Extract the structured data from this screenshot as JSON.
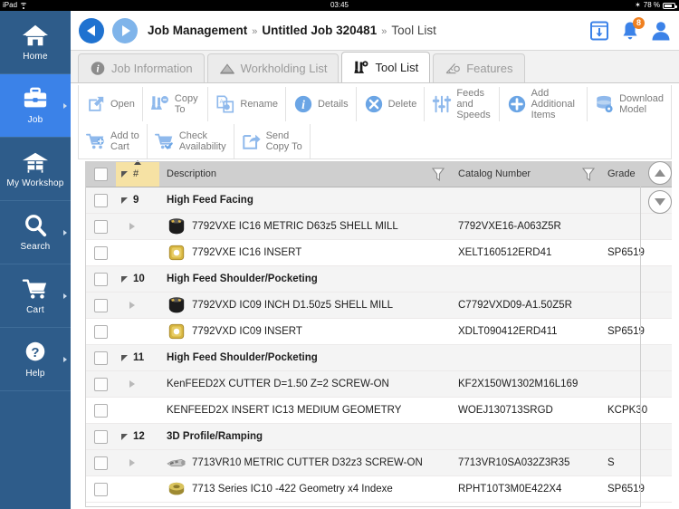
{
  "status_bar": {
    "device": "iPad",
    "wifi_icon": "wifi-icon",
    "time": "03:45",
    "bluetooth_icon": "bluetooth-icon",
    "battery_percent": "78 %",
    "battery_icon": "battery-icon"
  },
  "sidebar": {
    "items": [
      {
        "label": "Home",
        "icon": "home-icon",
        "active": false,
        "chevron": false
      },
      {
        "label": "Job",
        "icon": "briefcase-icon",
        "active": true,
        "chevron": true
      },
      {
        "label": "My Workshop",
        "icon": "workshop-icon",
        "active": false,
        "chevron": false
      },
      {
        "label": "Search",
        "icon": "magnifier-icon",
        "active": false,
        "chevron": true
      },
      {
        "label": "Cart",
        "icon": "cart-icon",
        "active": false,
        "chevron": true
      },
      {
        "label": "Help",
        "icon": "question-icon",
        "active": false,
        "chevron": true
      }
    ],
    "colors": {
      "background": "#2e5c8a",
      "active": "#3b82e8"
    }
  },
  "header": {
    "back_icon": "back-arrow-icon",
    "forward_icon": "forward-arrow-icon",
    "breadcrumb": {
      "root": "Job Management",
      "sep": "»",
      "job": "Untitled Job 320481",
      "current": "Tool List"
    },
    "download_icon": "download-to-device-icon",
    "notifications_icon": "bell-icon",
    "notifications_count": "8",
    "account_icon": "user-avatar-icon",
    "badge_color": "#f08020"
  },
  "tabs": [
    {
      "label": "Job Information",
      "icon": "info-icon",
      "active": false
    },
    {
      "label": "Workholding List",
      "icon": "workholding-icon",
      "active": false
    },
    {
      "label": "Tool List",
      "icon": "tool-icon",
      "active": true
    },
    {
      "label": "Features",
      "icon": "features-icon",
      "active": false
    }
  ],
  "toolbar": {
    "row1": [
      {
        "label": "Open",
        "icon": "open-icon"
      },
      {
        "label": "Copy To",
        "icon": "copy-to-icon"
      },
      {
        "label": "Rename",
        "icon": "rename-icon"
      },
      {
        "label": "Details",
        "icon": "details-info-icon"
      },
      {
        "label": "Delete",
        "icon": "delete-x-icon"
      },
      {
        "label": "Feeds and\nSpeeds",
        "icon": "sliders-icon"
      },
      {
        "label": "Add Additional\nItems",
        "icon": "plus-circle-icon"
      },
      {
        "label": "Download\nModel",
        "icon": "download-model-icon"
      }
    ],
    "row2": [
      {
        "label": "Add to\nCart",
        "icon": "add-to-cart-icon"
      },
      {
        "label": "Check\nAvailability",
        "icon": "check-availability-icon"
      },
      {
        "label": "Send\nCopy To",
        "icon": "send-copy-icon"
      }
    ]
  },
  "table": {
    "columns": {
      "checkbox": "",
      "number": "#",
      "description": "Description",
      "catalog": "Catalog Number",
      "grade": "Grade"
    },
    "sort_column": "#",
    "sort_direction": "asc",
    "filters": [
      "description-filter",
      "catalog-filter"
    ],
    "scroll_up_icon": "scroll-up-icon",
    "scroll_down_icon": "scroll-down-icon",
    "rows": [
      {
        "type": "group",
        "num": "9",
        "description": "High Feed Facing",
        "catalog": "",
        "grade": "",
        "thumb": "none",
        "shade": true
      },
      {
        "type": "item",
        "num": "",
        "description": "7792VXE IC16 METRIC D63z5 SHELL MILL",
        "catalog": "7792VXE16-A063Z5R",
        "grade": "",
        "thumb": "shell-mill-black",
        "shade": true,
        "expandable": true
      },
      {
        "type": "item",
        "num": "",
        "description": "7792VXE IC16 INSERT",
        "catalog": "XELT160512ERD41",
        "grade": "SP6519",
        "thumb": "insert-gold-square",
        "shade": false
      },
      {
        "type": "group",
        "num": "10",
        "description": "High Feed Shoulder/Pocketing",
        "catalog": "",
        "grade": "",
        "thumb": "none",
        "shade": true
      },
      {
        "type": "item",
        "num": "",
        "description": "7792VXD IC09  INCH D1.50z5 SHELL MILL",
        "catalog": "C7792VXD09-A1.50Z5R",
        "grade": "",
        "thumb": "shell-mill-black",
        "shade": true,
        "expandable": true
      },
      {
        "type": "item",
        "num": "",
        "description": "7792VXD IC09 INSERT",
        "catalog": "XDLT090412ERD411",
        "grade": "SP6519",
        "thumb": "insert-gold-square",
        "shade": false
      },
      {
        "type": "group",
        "num": "11",
        "description": "High Feed Shoulder/Pocketing",
        "catalog": "",
        "grade": "",
        "thumb": "none",
        "shade": true
      },
      {
        "type": "item",
        "num": "",
        "description": "KenFEED2X CUTTER D=1.50 Z=2 SCREW-ON",
        "catalog": "KF2X150W1302M16L169",
        "grade": "",
        "thumb": "none",
        "shade": true,
        "expandable": true
      },
      {
        "type": "item",
        "num": "",
        "description": "KENFEED2X INSERT IC13 MEDIUM GEOMETRY",
        "catalog": "WOEJ130713SRGD",
        "grade": "KCPK30",
        "thumb": "none",
        "shade": false
      },
      {
        "type": "group",
        "num": "12",
        "description": "3D Profile/Ramping",
        "catalog": "",
        "grade": "",
        "thumb": "none",
        "shade": true
      },
      {
        "type": "item",
        "num": "",
        "description": "7713VR10 METRIC CUTTER D32z3 SCREW-ON",
        "catalog": "7713VR10SA032Z3R35",
        "grade": "S",
        "thumb": "cutter-silver",
        "shade": true,
        "expandable": true
      },
      {
        "type": "item",
        "num": "",
        "description": "7713 Series IC10 -422 Geometry x4 Indexe",
        "catalog": "RPHT10T3M0E422X4",
        "grade": "SP6519",
        "thumb": "insert-gold-round",
        "shade": false
      }
    ]
  }
}
